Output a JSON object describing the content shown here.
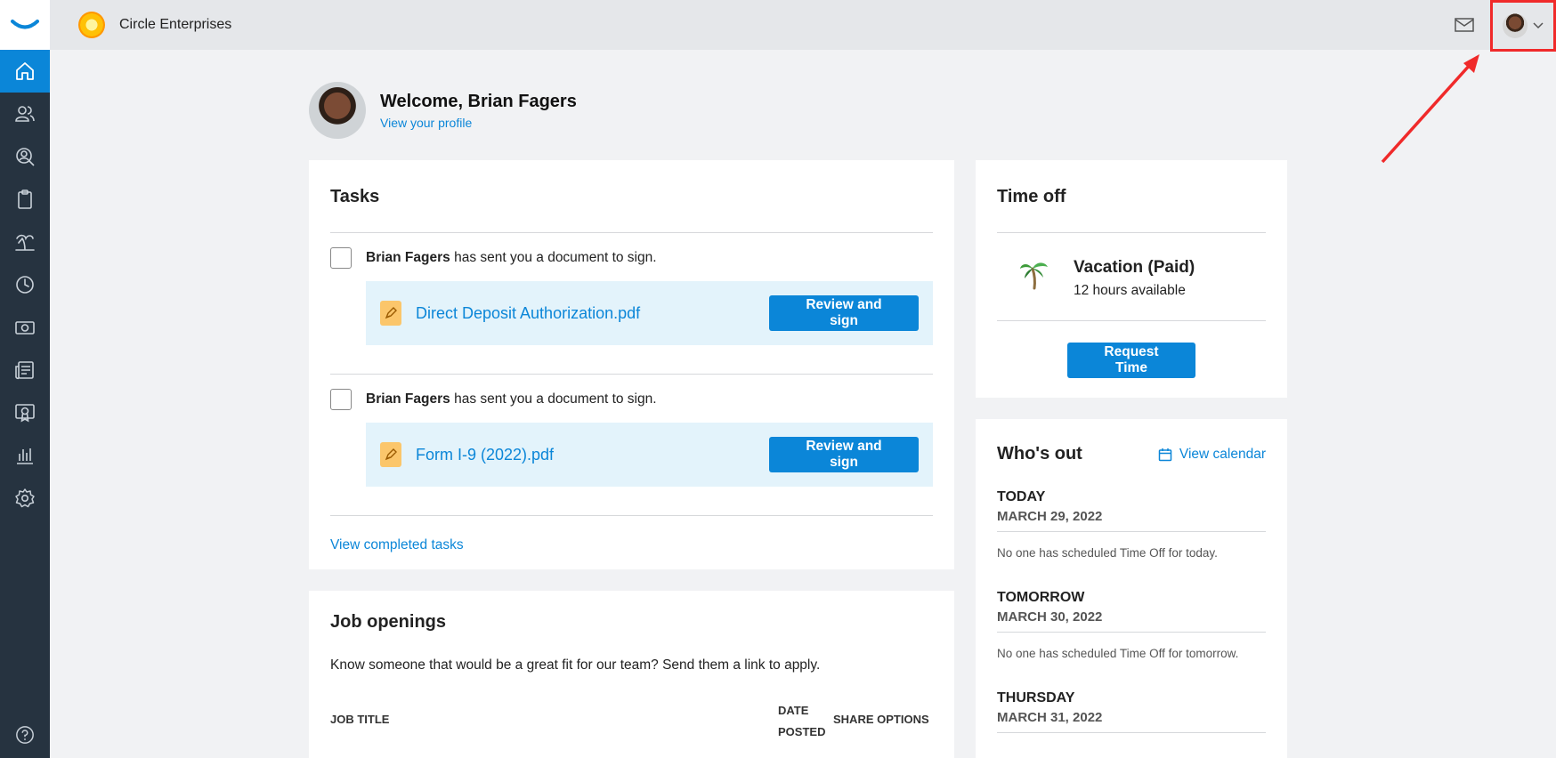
{
  "header": {
    "company_name": "Circle Enterprises"
  },
  "welcome": {
    "title": "Welcome, Brian Fagers",
    "profile_link": "View your profile"
  },
  "tasks": {
    "title": "Tasks",
    "items": [
      {
        "sender": "Brian Fagers",
        "message": " has sent you a document to sign.",
        "document": "Direct Deposit Authorization.pdf",
        "button": "Review and sign"
      },
      {
        "sender": "Brian Fagers",
        "message": " has sent you a document to sign.",
        "document": "Form I-9 (2022).pdf",
        "button": "Review and sign"
      }
    ],
    "view_completed": "View completed tasks"
  },
  "jobs": {
    "title": "Job openings",
    "description": "Know someone that would be a great fit for our team? Send them a link to apply.",
    "col_title": "JOB TITLE",
    "col_date_1": "DATE",
    "col_date_2": "POSTED",
    "col_share": "SHARE OPTIONS"
  },
  "time_off": {
    "title": "Time off",
    "type": "Vacation (Paid)",
    "available": "12 hours available",
    "button": "Request Time"
  },
  "whos_out": {
    "title": "Who's out",
    "calendar_link": "View calendar",
    "days": [
      {
        "label": "TODAY",
        "date": "MARCH 29, 2022",
        "empty": "No one has scheduled Time Off for today."
      },
      {
        "label": "TOMORROW",
        "date": "MARCH 30, 2022",
        "empty": "No one has scheduled Time Off for tomorrow."
      },
      {
        "label": "THURSDAY",
        "date": "MARCH 31, 2022"
      }
    ]
  },
  "colors": {
    "accent": "#0b86d8",
    "sidebar": "#263340",
    "highlight": "#f02a2a"
  }
}
